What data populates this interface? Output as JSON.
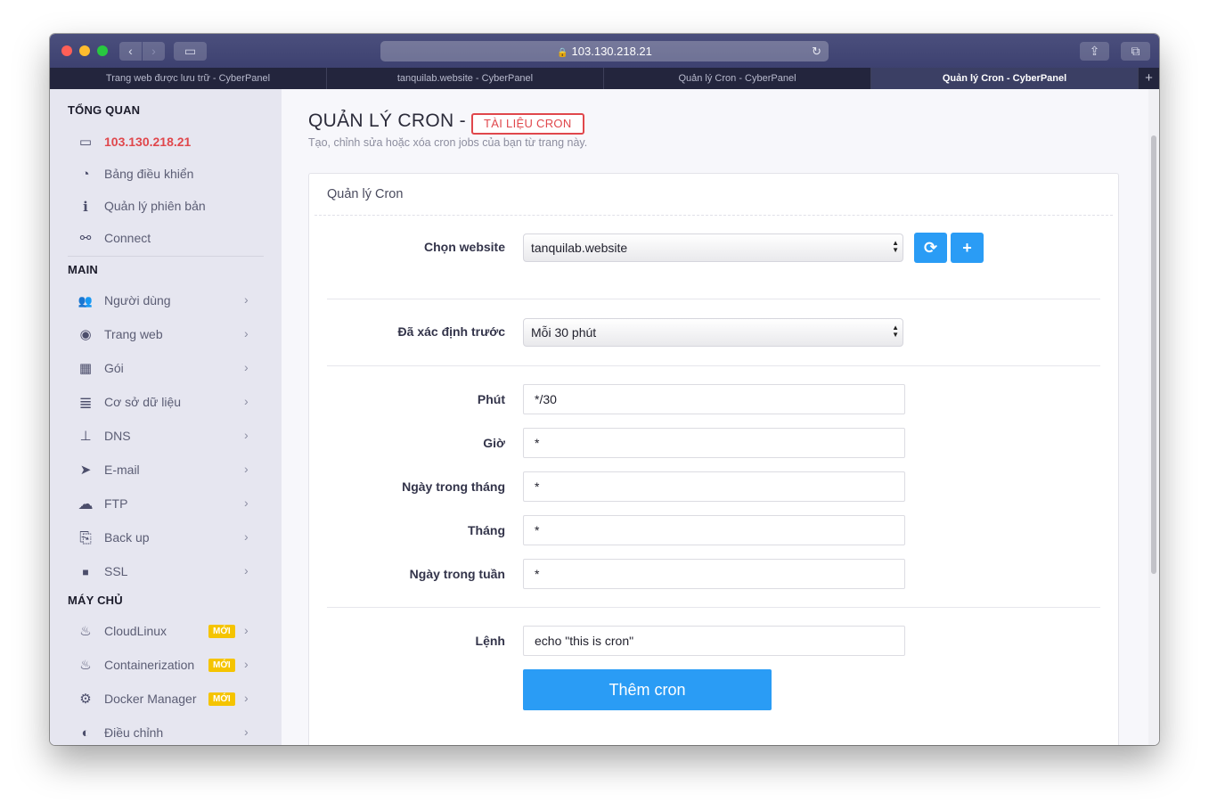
{
  "browser": {
    "url": "103.130.218.21",
    "tabs": [
      {
        "label": "Trang web được lưu trữ - CyberPanel",
        "active": false
      },
      {
        "label": "tanquilab.website - CyberPanel",
        "active": false
      },
      {
        "label": "Quản lý Cron - CyberPanel",
        "active": false
      },
      {
        "label": "Quản lý Cron - CyberPanel",
        "active": true
      }
    ],
    "new_tab": "+",
    "icons": {
      "back": "‹",
      "forward": "›",
      "sidebar": "▭",
      "reload": "↻",
      "share": "⇪",
      "tabs": "⧉",
      "lock": "🔒"
    }
  },
  "sidebar": {
    "sections": [
      {
        "title": "TỔNG QUAN",
        "items": [
          {
            "label": "103.130.218.21",
            "icon": "laptop-icon",
            "glyph": "▭",
            "highlight": true
          },
          {
            "label": "Bảng điều khiển",
            "icon": "dashboard-icon",
            "glyph": "◔"
          },
          {
            "label": "Quản lý phiên bản",
            "icon": "info-icon",
            "glyph": "i"
          },
          {
            "label": "Connect",
            "icon": "link-icon",
            "glyph": "⚯"
          }
        ]
      },
      {
        "title": "MAIN",
        "items": [
          {
            "label": "Người dùng",
            "icon": "users-icon",
            "glyph": "👥"
          },
          {
            "label": "Trang web",
            "icon": "globe-icon",
            "glyph": "◉"
          },
          {
            "label": "Gói",
            "icon": "packages-icon",
            "glyph": "▦"
          },
          {
            "label": "Cơ sở dữ liệu",
            "icon": "database-icon",
            "glyph": "≣"
          },
          {
            "label": "DNS",
            "icon": "sitemap-icon",
            "glyph": "⊥"
          },
          {
            "label": "E-mail",
            "icon": "paper-plane-icon",
            "glyph": "➤"
          },
          {
            "label": "FTP",
            "icon": "cloud-upload-icon",
            "glyph": "☁"
          },
          {
            "label": "Back up",
            "icon": "copy-icon",
            "glyph": "⎘"
          },
          {
            "label": "SSL",
            "icon": "lock-icon",
            "glyph": "■"
          }
        ]
      },
      {
        "title": "MÁY CHỦ",
        "items": [
          {
            "label": "CloudLinux",
            "icon": "fire-icon",
            "glyph": "♨",
            "badge": "MỚI"
          },
          {
            "label": "Containerization",
            "icon": "fire-icon",
            "glyph": "♨",
            "badge": "MỚI"
          },
          {
            "label": "Docker Manager",
            "icon": "cogs-icon",
            "glyph": "⚙",
            "badge": "MỚI"
          },
          {
            "label": "Điều chỉnh",
            "icon": "adjust-icon",
            "glyph": "◐"
          }
        ]
      }
    ],
    "chevron": "›"
  },
  "page": {
    "title": "QUẢN LÝ CRON -",
    "doc_badge": "TÀI LIỆU CRON",
    "subtitle": "Tạo, chỉnh sửa hoặc xóa cron jobs của bạn từ trang này."
  },
  "panel": {
    "title": "Quản lý Cron",
    "website_label": "Chọn website",
    "website_value": "tanquilab.website",
    "refresh_glyph": "⟳",
    "add_glyph": "+",
    "preset_label": "Đã xác định trước",
    "preset_value": "Mỗi 30 phút",
    "fields": [
      {
        "label": "Phút",
        "value": "*/30"
      },
      {
        "label": "Giờ",
        "value": "*"
      },
      {
        "label": "Ngày trong tháng",
        "value": "*"
      },
      {
        "label": "Tháng",
        "value": "*"
      },
      {
        "label": "Ngày trong tuần",
        "value": "*"
      }
    ],
    "command_label": "Lệnh",
    "command_value": "echo \"this is cron\"",
    "submit_label": "Thêm cron"
  }
}
